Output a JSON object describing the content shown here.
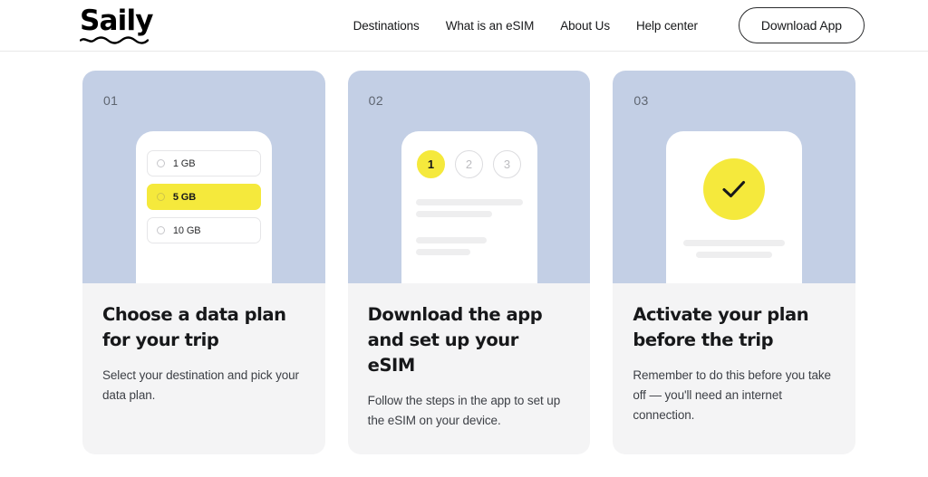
{
  "header": {
    "logo_text": "Saily",
    "logo_icon": "wave-underline-icon",
    "nav": [
      {
        "label": "Destinations"
      },
      {
        "label": "What is an eSIM"
      },
      {
        "label": "About Us"
      },
      {
        "label": "Help center"
      }
    ],
    "cta_label": "Download App"
  },
  "colors": {
    "illustration_bg": "#c3cfe5",
    "card_bg": "#f4f4f5",
    "accent_yellow": "#f5e93c",
    "text_dark": "#17181a",
    "text_muted": "#3d4046",
    "step_number": "#5e6570",
    "skeleton": "#eeeeef"
  },
  "cards": [
    {
      "step": "01",
      "title": "Choose a data plan for your trip",
      "description": "Select your destination and pick your data plan.",
      "illustration": "phone-plan-picker",
      "plans": [
        {
          "label": "1 GB",
          "selected": false
        },
        {
          "label": "5 GB",
          "selected": true
        },
        {
          "label": "10 GB",
          "selected": false
        }
      ]
    },
    {
      "step": "02",
      "title": "Download the app and set up your eSIM",
      "description": "Follow the steps in the app to set up the eSIM on your device.",
      "illustration": "phone-setup-steps",
      "steps": [
        {
          "label": "1",
          "active": true
        },
        {
          "label": "2",
          "active": false
        },
        {
          "label": "3",
          "active": false
        }
      ]
    },
    {
      "step": "03",
      "title": "Activate your plan before the trip",
      "description": "Remember to do this before you take off — you'll need an internet connection.",
      "illustration": "phone-activation-success",
      "status_icon": "checkmark-icon"
    }
  ]
}
